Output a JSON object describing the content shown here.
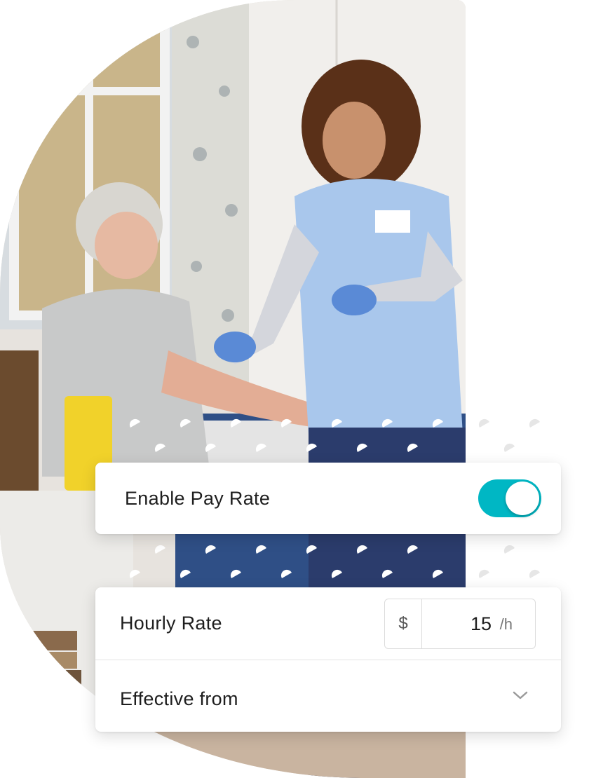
{
  "enable_card": {
    "label": "Enable Pay Rate",
    "toggle_on": true
  },
  "rate_card": {
    "hourly_label": "Hourly Rate",
    "currency_symbol": "$",
    "rate_value": "15",
    "rate_unit": "/h",
    "effective_label": "Effective from"
  },
  "colors": {
    "toggle_on": "#00b7c4"
  },
  "icons": {
    "toggle_knob": "toggle-knob",
    "dropdown": "chevron-down-icon"
  }
}
